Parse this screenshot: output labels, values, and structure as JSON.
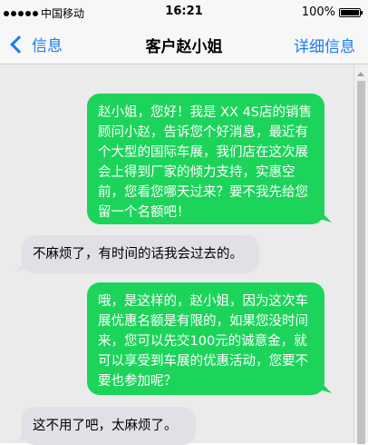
{
  "status_bar": {
    "carrier": "中国移动",
    "time": "16:21",
    "battery": "100%",
    "battery_level": 1.0
  },
  "nav": {
    "back_label": "信息",
    "title": "客户赵小姐",
    "detail_label": "详细信息"
  },
  "messages": [
    {
      "direction": "outgoing",
      "text": "赵小姐，您好！我是 XX 4S店的销售顾问小赵，告诉您个好消息，最近有个大型的国际车展，我们店在这次展会上得到厂家的倾力支持，实惠空前，您看您哪天过来？要不我先给您留一个名额吧！"
    },
    {
      "direction": "incoming",
      "text": "不麻烦了，有时间的话我会过去的。"
    },
    {
      "direction": "outgoing",
      "text": "哦，是这样的，赵小姐，因为这次车展优惠名额是有限的，如果您没时间来，您可以先交100元的诚意金，就可以享受到车展的优惠活动，您要不要也参加呢？"
    },
    {
      "direction": "incoming",
      "text": "这不用了吧，太麻烦了。"
    }
  ],
  "colors": {
    "outgoing_bubble": "#1dd45b",
    "incoming_bubble": "#e0e0e6",
    "accent": "#1a7cf5",
    "chat_background": "#ebebeb"
  }
}
